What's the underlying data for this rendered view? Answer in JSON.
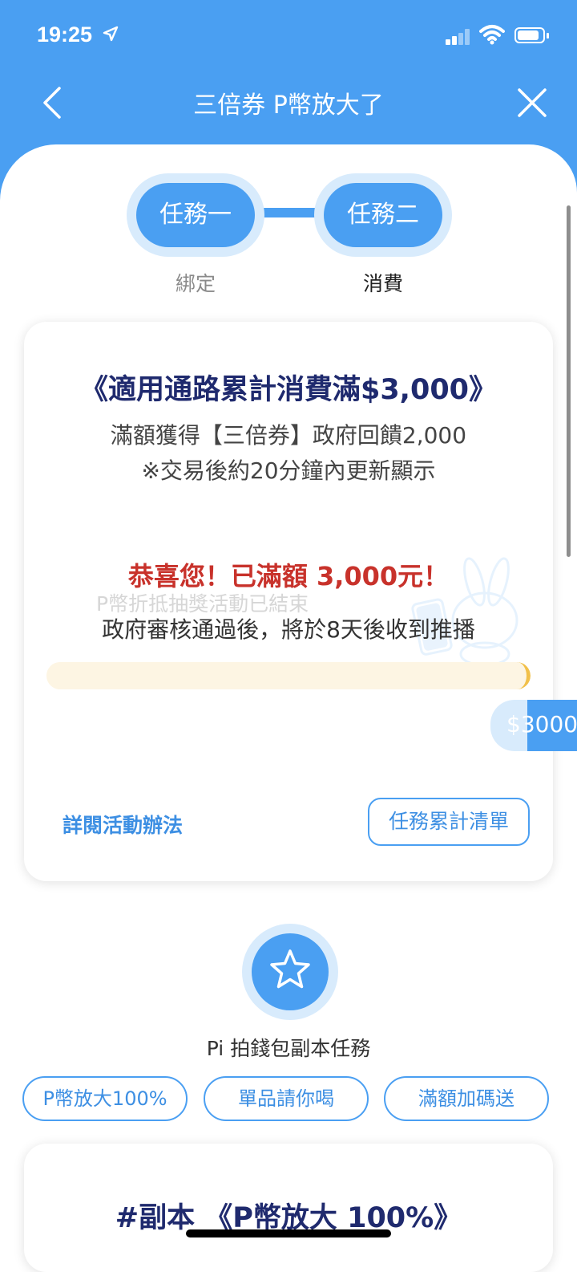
{
  "status_bar": {
    "time": "19:25"
  },
  "nav": {
    "title": "三倍券 P幣放大了"
  },
  "steps": [
    {
      "label": "任務一",
      "caption": "綁定"
    },
    {
      "label": "任務二",
      "caption": "消費"
    }
  ],
  "card": {
    "title": "《適用通路累計消費滿$3,000》",
    "subtitle": "滿額獲得【三倍券】政府回饋2,000",
    "note": "※交易後約20分鐘內更新顯示",
    "ghost_text": "P幣折抵抽獎活動已結束",
    "congrats": "恭喜您！已滿額 3,000元！",
    "gov_note": "政府審核通過後，將於8天後收到推播",
    "progress_fraction": 1.0,
    "progress_amount": "$3000",
    "link_rules": "詳閱活動辦法",
    "button_list": "任務累計清單"
  },
  "sub_section": {
    "caption": "Pi 拍錢包副本任務",
    "chips": [
      "P幣放大100%",
      "單品請你喝",
      "滿額加碼送"
    ]
  },
  "card2": {
    "title": "#副本 《P幣放大 100%》"
  },
  "colors": {
    "primary": "#4a9ff2",
    "title_navy": "#1f2a6e",
    "congrats_red": "#c8322b",
    "progress_bg": "#fdf5e3"
  }
}
